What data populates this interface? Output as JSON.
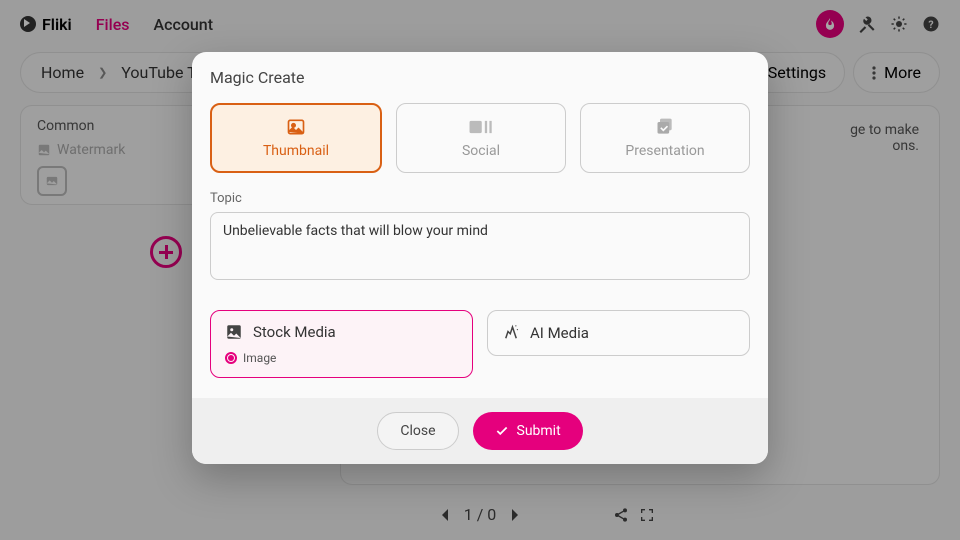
{
  "brand": "Fliki",
  "nav": {
    "files": "Files",
    "account": "Account"
  },
  "breadcrumb": {
    "home": "Home",
    "current": "YouTube Th"
  },
  "actions": {
    "settings": "Settings",
    "more": "More"
  },
  "sidebar": {
    "title": "Common",
    "watermark": "Watermark"
  },
  "hint": {
    "line1": "ge to make",
    "line2": "ons."
  },
  "pager": "1 / 0",
  "modal": {
    "title": "Magic Create",
    "formats": {
      "thumbnail": "Thumbnail",
      "social": "Social",
      "presentation": "Presentation"
    },
    "topic_label": "Topic",
    "topic_value": "Unbelievable facts that will blow your mind",
    "media": {
      "stock": "Stock Media",
      "ai": "AI Media",
      "image": "Image"
    },
    "buttons": {
      "close": "Close",
      "submit": "Submit"
    }
  }
}
